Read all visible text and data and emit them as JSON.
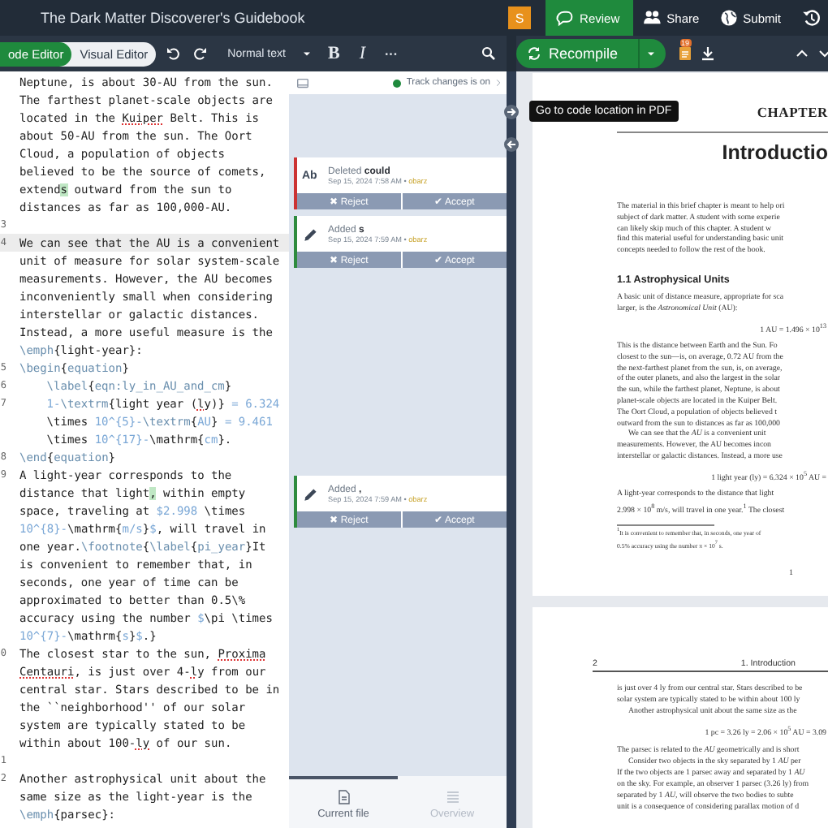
{
  "top_bar": {
    "title": "The Dark Matter Discoverer's Guidebook",
    "avatar": "S",
    "buttons": [
      {
        "label": "Review",
        "selected": true
      },
      {
        "label": "Share",
        "selected": false
      },
      {
        "label": "Submit",
        "selected": false
      }
    ]
  },
  "toolbar": {
    "modes": [
      {
        "label": "ode Editor",
        "selected": true
      },
      {
        "label": "Visual Editor",
        "selected": false
      }
    ],
    "style": "Normal text",
    "format": [
      "B",
      "I",
      "···"
    ],
    "recompile": "Recompile",
    "log_badge": "19"
  },
  "editor": {
    "lines": [
      {
        "active": false,
        "segments": [
          {
            "kind": "text",
            "text": "Neptune, is about 30-AU from the sun."
          }
        ]
      },
      {
        "active": false,
        "segments": [
          {
            "kind": "text",
            "text": "The farthest planet-scale objects are"
          }
        ]
      },
      {
        "active": false,
        "segments": [
          {
            "kind": "text",
            "text": "located in the "
          },
          {
            "kind": "misspelled",
            "text": "Kuiper"
          },
          {
            "kind": "text",
            "text": " Belt. This is"
          }
        ]
      },
      {
        "active": false,
        "segments": [
          {
            "kind": "text",
            "text": "about 50-AU from the sun. The Oort"
          }
        ]
      },
      {
        "active": false,
        "segments": [
          {
            "kind": "text",
            "text": "Cloud, a population of objects"
          }
        ]
      },
      {
        "active": false,
        "segments": [
          {
            "kind": "text",
            "text": "believed to be the source of comets,"
          }
        ]
      },
      {
        "active": false,
        "segments": [
          {
            "kind": "text",
            "text": "extend"
          },
          {
            "kind": "added",
            "text": "s"
          },
          {
            "kind": "text",
            "text": " outward from the sun to"
          }
        ]
      },
      {
        "active": false,
        "segments": [
          {
            "kind": "text",
            "text": "distances as far as 100,000-AU."
          }
        ]
      },
      {
        "n": "3",
        "active": false
      },
      {
        "n": "4",
        "active": true,
        "segments": [
          {
            "kind": "text",
            "text": "We can see that the AU is a convenient"
          }
        ]
      },
      {
        "active": false,
        "segments": [
          {
            "kind": "text",
            "text": "unit of measure for solar system-scale"
          }
        ]
      },
      {
        "active": false,
        "segments": [
          {
            "kind": "text",
            "text": "measurements. However, the AU becomes"
          }
        ]
      },
      {
        "active": false,
        "segments": [
          {
            "kind": "text",
            "text": "inconveniently small when considering"
          }
        ]
      },
      {
        "active": false,
        "segments": [
          {
            "kind": "text",
            "text": "interstellar or galactic distances."
          }
        ]
      },
      {
        "active": false,
        "segments": [
          {
            "kind": "text",
            "text": "Instead, a more useful measure is the"
          }
        ]
      },
      {
        "active": false,
        "segments": [
          {
            "kind": "command",
            "text": "\\emph"
          },
          {
            "kind": "text",
            "text": "{light-year}:"
          }
        ]
      },
      {
        "n": "5",
        "active": false,
        "segments": [
          {
            "kind": "command",
            "text": "\\begin"
          },
          {
            "kind": "text",
            "text": "{"
          },
          {
            "kind": "command",
            "text": "equation"
          },
          {
            "kind": "text",
            "text": "}"
          }
        ]
      },
      {
        "n": "6",
        "active": false,
        "indented": true,
        "segments": [
          {
            "kind": "command",
            "text": "\\label"
          },
          {
            "kind": "text",
            "text": "{"
          },
          {
            "kind": "command",
            "text": "eqn:ly_in_AU_and_cm"
          },
          {
            "kind": "text",
            "text": "}"
          }
        ]
      },
      {
        "n": "7",
        "active": false,
        "indented": true,
        "segments": [
          {
            "kind": "math",
            "text": "1-"
          },
          {
            "kind": "command",
            "text": "\\textrm"
          },
          {
            "kind": "text",
            "text": "{light year ("
          },
          {
            "kind": "misspelled",
            "text": "ly"
          },
          {
            "kind": "text",
            "text": ")} "
          },
          {
            "kind": "math",
            "text": "= 6.324"
          }
        ]
      },
      {
        "active": false,
        "indented": true,
        "segments": [
          {
            "kind": "text",
            "text": "\\times "
          },
          {
            "kind": "math",
            "text": "10^{5}-"
          },
          {
            "kind": "command",
            "text": "\\textrm"
          },
          {
            "kind": "text",
            "text": "{"
          },
          {
            "kind": "math",
            "text": "AU"
          },
          {
            "kind": "text",
            "text": "} "
          },
          {
            "kind": "math",
            "text": "= 9.461"
          }
        ]
      },
      {
        "active": false,
        "indented": true,
        "segments": [
          {
            "kind": "text",
            "text": "\\times "
          },
          {
            "kind": "math",
            "text": "10^{17}-"
          },
          {
            "kind": "text",
            "text": "\\mathrm{"
          },
          {
            "kind": "math",
            "text": "cm"
          },
          {
            "kind": "text",
            "text": "}."
          }
        ]
      },
      {
        "n": "8",
        "active": false,
        "segments": [
          {
            "kind": "command",
            "text": "\\end"
          },
          {
            "kind": "text",
            "text": "{"
          },
          {
            "kind": "command",
            "text": "equation"
          },
          {
            "kind": "text",
            "text": "}"
          }
        ]
      },
      {
        "n": "9",
        "active": false,
        "segments": [
          {
            "kind": "text",
            "text": "A light-year corresponds to the"
          }
        ]
      },
      {
        "active": false,
        "segments": [
          {
            "kind": "text",
            "text": "distance that light"
          },
          {
            "kind": "added",
            "text": ","
          },
          {
            "kind": "text",
            "text": " within empty"
          }
        ]
      },
      {
        "active": false,
        "segments": [
          {
            "kind": "text",
            "text": "space, traveling at "
          },
          {
            "kind": "math",
            "text": "$2.998"
          },
          {
            "kind": "text",
            "text": " \\times"
          }
        ]
      },
      {
        "active": false,
        "segments": [
          {
            "kind": "math",
            "text": "10^{8}-"
          },
          {
            "kind": "text",
            "text": "\\mathrm{"
          },
          {
            "kind": "math",
            "text": "m/s"
          },
          {
            "kind": "text",
            "text": "}"
          },
          {
            "kind": "math",
            "text": "$"
          },
          {
            "kind": "text",
            "text": ", will travel in"
          }
        ]
      },
      {
        "active": false,
        "segments": [
          {
            "kind": "text",
            "text": "one year."
          },
          {
            "kind": "command",
            "text": "\\footnote"
          },
          {
            "kind": "text",
            "text": "{"
          },
          {
            "kind": "command",
            "text": "\\label"
          },
          {
            "kind": "text",
            "text": "{"
          },
          {
            "kind": "command",
            "text": "pi_year"
          },
          {
            "kind": "text",
            "text": "}It"
          }
        ]
      },
      {
        "active": false,
        "segments": [
          {
            "kind": "text",
            "text": "is convenient to remember that, in"
          }
        ]
      },
      {
        "active": false,
        "segments": [
          {
            "kind": "text",
            "text": "seconds, one year of time can be"
          }
        ]
      },
      {
        "active": false,
        "segments": [
          {
            "kind": "text",
            "text": "approximated to better than 0.5\\%"
          }
        ]
      },
      {
        "active": false,
        "segments": [
          {
            "kind": "text",
            "text": "accuracy using the number "
          },
          {
            "kind": "math",
            "text": "$"
          },
          {
            "kind": "text",
            "text": "\\pi \\times"
          }
        ]
      },
      {
        "active": false,
        "segments": [
          {
            "kind": "math",
            "text": "10^{7}-"
          },
          {
            "kind": "text",
            "text": "\\mathrm{"
          },
          {
            "kind": "math",
            "text": "s"
          },
          {
            "kind": "text",
            "text": "}"
          },
          {
            "kind": "math",
            "text": "$"
          },
          {
            "kind": "text",
            "text": ".}"
          }
        ]
      },
      {
        "n": "0",
        "active": false,
        "segments": [
          {
            "kind": "text",
            "text": "The closest star to the sun, "
          },
          {
            "kind": "misspelled",
            "text": "Proxima"
          }
        ]
      },
      {
        "active": false,
        "segments": [
          {
            "kind": "misspelled",
            "text": "Centauri"
          },
          {
            "kind": "text",
            "text": ", is just over 4-"
          },
          {
            "kind": "misspelled",
            "text": "ly"
          },
          {
            "kind": "text",
            "text": " from our"
          }
        ]
      },
      {
        "active": false,
        "segments": [
          {
            "kind": "text",
            "text": "central star. Stars described to be in"
          }
        ]
      },
      {
        "active": false,
        "segments": [
          {
            "kind": "text",
            "text": "the ``neighborhood'' of our solar"
          }
        ]
      },
      {
        "active": false,
        "segments": [
          {
            "kind": "text",
            "text": "system are typically stated to be"
          }
        ]
      },
      {
        "active": false,
        "segments": [
          {
            "kind": "text",
            "text": "within about 100-"
          },
          {
            "kind": "misspelled",
            "text": "ly"
          },
          {
            "kind": "text",
            "text": " of our sun."
          }
        ]
      },
      {
        "n": "1",
        "active": false
      },
      {
        "n": "2",
        "active": false,
        "segments": [
          {
            "kind": "text",
            "text": "Another astrophysical unit about the"
          }
        ]
      },
      {
        "active": false,
        "segments": [
          {
            "kind": "text",
            "text": "same size as the light-year is the"
          }
        ]
      },
      {
        "active": false,
        "segments": [
          {
            "kind": "command",
            "text": "\\emph"
          },
          {
            "kind": "text",
            "text": "{parsec}:"
          }
        ]
      }
    ]
  },
  "review": {
    "track_changes": {
      "label": "Track changes is on",
      "on": true
    },
    "changes": [
      {
        "kind": "deleted",
        "icon_text": "Ab",
        "title": "Deleted **could**",
        "date": "Sep 15, 2024 7:58 AM • ",
        "author": "obarz",
        "reject": "✖ Reject",
        "accept": "✔ Accept"
      },
      {
        "kind": "added",
        "title": "Added **s**",
        "date": "Sep 15, 2024 7:59 AM • ",
        "author": "obarz",
        "reject": "✖ Reject",
        "accept": "✔ Accept"
      },
      {
        "kind": "added",
        "title": "Added **,**",
        "date": "Sep 15, 2024 7:59 AM • ",
        "author": "obarz",
        "reject": "✖ Reject",
        "accept": "✔ Accept"
      }
    ],
    "tabs": [
      {
        "label": "Current file",
        "selected": true
      },
      {
        "label": "Overview",
        "selected": false
      }
    ]
  },
  "tooltip": "Go to code location in PDF",
  "pdf": {
    "pages": [
      {
        "lines": [
          {
            "kind": "chapter",
            "text": "CHAPTER"
          },
          {
            "kind": "title",
            "text": "Introductio"
          },
          {
            "kind": "text",
            "text": "The material in this brief chapter is meant to help ori"
          },
          {
            "kind": "text",
            "text": "subject of dark matter. A student with some experie"
          },
          {
            "kind": "text",
            "text": "can likely skip much of this chapter. A student w"
          },
          {
            "kind": "text",
            "text": "find this material useful for understanding basic unit"
          },
          {
            "kind": "text",
            "text": "concepts needed to follow the rest of the book."
          },
          {
            "kind": "section",
            "text": "1.1   Astrophysical Units"
          },
          {
            "kind": "text",
            "text": "A basic unit of distance measure, appropriate for sca"
          },
          {
            "kind": "text",
            "text": "larger, is the *Astronomical Unit* (AU):"
          },
          {
            "kind": "equation",
            "text": "1 AU = 1.496 × 10$^{13}$"
          },
          {
            "kind": "text",
            "text": "This is the distance between Earth and the Sun. Fo"
          },
          {
            "kind": "text",
            "text": "closest to the sun—is, on average, 0.72 AU from the"
          },
          {
            "kind": "text",
            "text": "the next-farthest planet from the sun, is, on average,"
          },
          {
            "kind": "text",
            "text": "of the outer planets, and also the largest in the solar"
          },
          {
            "kind": "text",
            "text": "the sun, while the farthest planet, Neptune, is about"
          },
          {
            "kind": "text",
            "text": "planet-scale objects are located in the Kuiper Belt."
          },
          {
            "kind": "text",
            "text": "The Oort Cloud, a population of objects believed t"
          },
          {
            "kind": "text",
            "text": "outward from the sun to distances as far as 100,000"
          },
          {
            "kind": "indent",
            "text": "We can see that the *AU* is a convenient unit"
          },
          {
            "kind": "text",
            "text": "measurements. However, the AU becomes incon"
          },
          {
            "kind": "text",
            "text": "interstellar or galactic distances. Instead, a more use"
          },
          {
            "kind": "equation",
            "text": "1 light year (ly) = 6.324 × 10$^{5}$ AU ="
          },
          {
            "kind": "text",
            "text": "A light-year corresponds to the distance that light"
          },
          {
            "kind": "text",
            "text": "2.998 × 10$^{8}$ m/s, will travel in one year.$^{1}$ The closest"
          },
          {
            "kind": "footnote",
            "text": "$^{1}$It is convenient to remember that, in seconds, one year of"
          },
          {
            "kind": "footnote",
            "text": "0.5% accuracy using the number π × 10$^{7}$ s."
          },
          {
            "kind": "page_number",
            "text": "1"
          }
        ]
      },
      {
        "lines": [
          {
            "kind": "running_head",
            "text": "2",
            "head": "1.  Introduction"
          },
          {
            "kind": "text",
            "text": "is just over 4 ly from our central star. Stars described to be"
          },
          {
            "kind": "text",
            "text": "solar system are typically stated to be within about 100 ly"
          },
          {
            "kind": "indent",
            "text": "Another astrophysical unit about the same size as the"
          },
          {
            "kind": "equation",
            "text": "1 pc = 3.26 ly = 2.06 × 10$^{5}$ AU = 3.09"
          },
          {
            "kind": "text",
            "text": "The parsec is related to the *AU* geometrically and is short"
          },
          {
            "kind": "indent",
            "text": "Consider two objects in the sky separated by 1 *AU* per"
          },
          {
            "kind": "text",
            "text": "If the two objects are 1 parsec away and separated by 1 *AU*"
          },
          {
            "kind": "text",
            "text": "on the sky. For example, an observer 1 parsec (3.26 ly) from"
          },
          {
            "kind": "text",
            "text": "separated by 1 *AU*, will observe the two bodies to subte"
          },
          {
            "kind": "text",
            "text": "unit is a consequence of considering parallax motion of d"
          }
        ]
      }
    ]
  }
}
